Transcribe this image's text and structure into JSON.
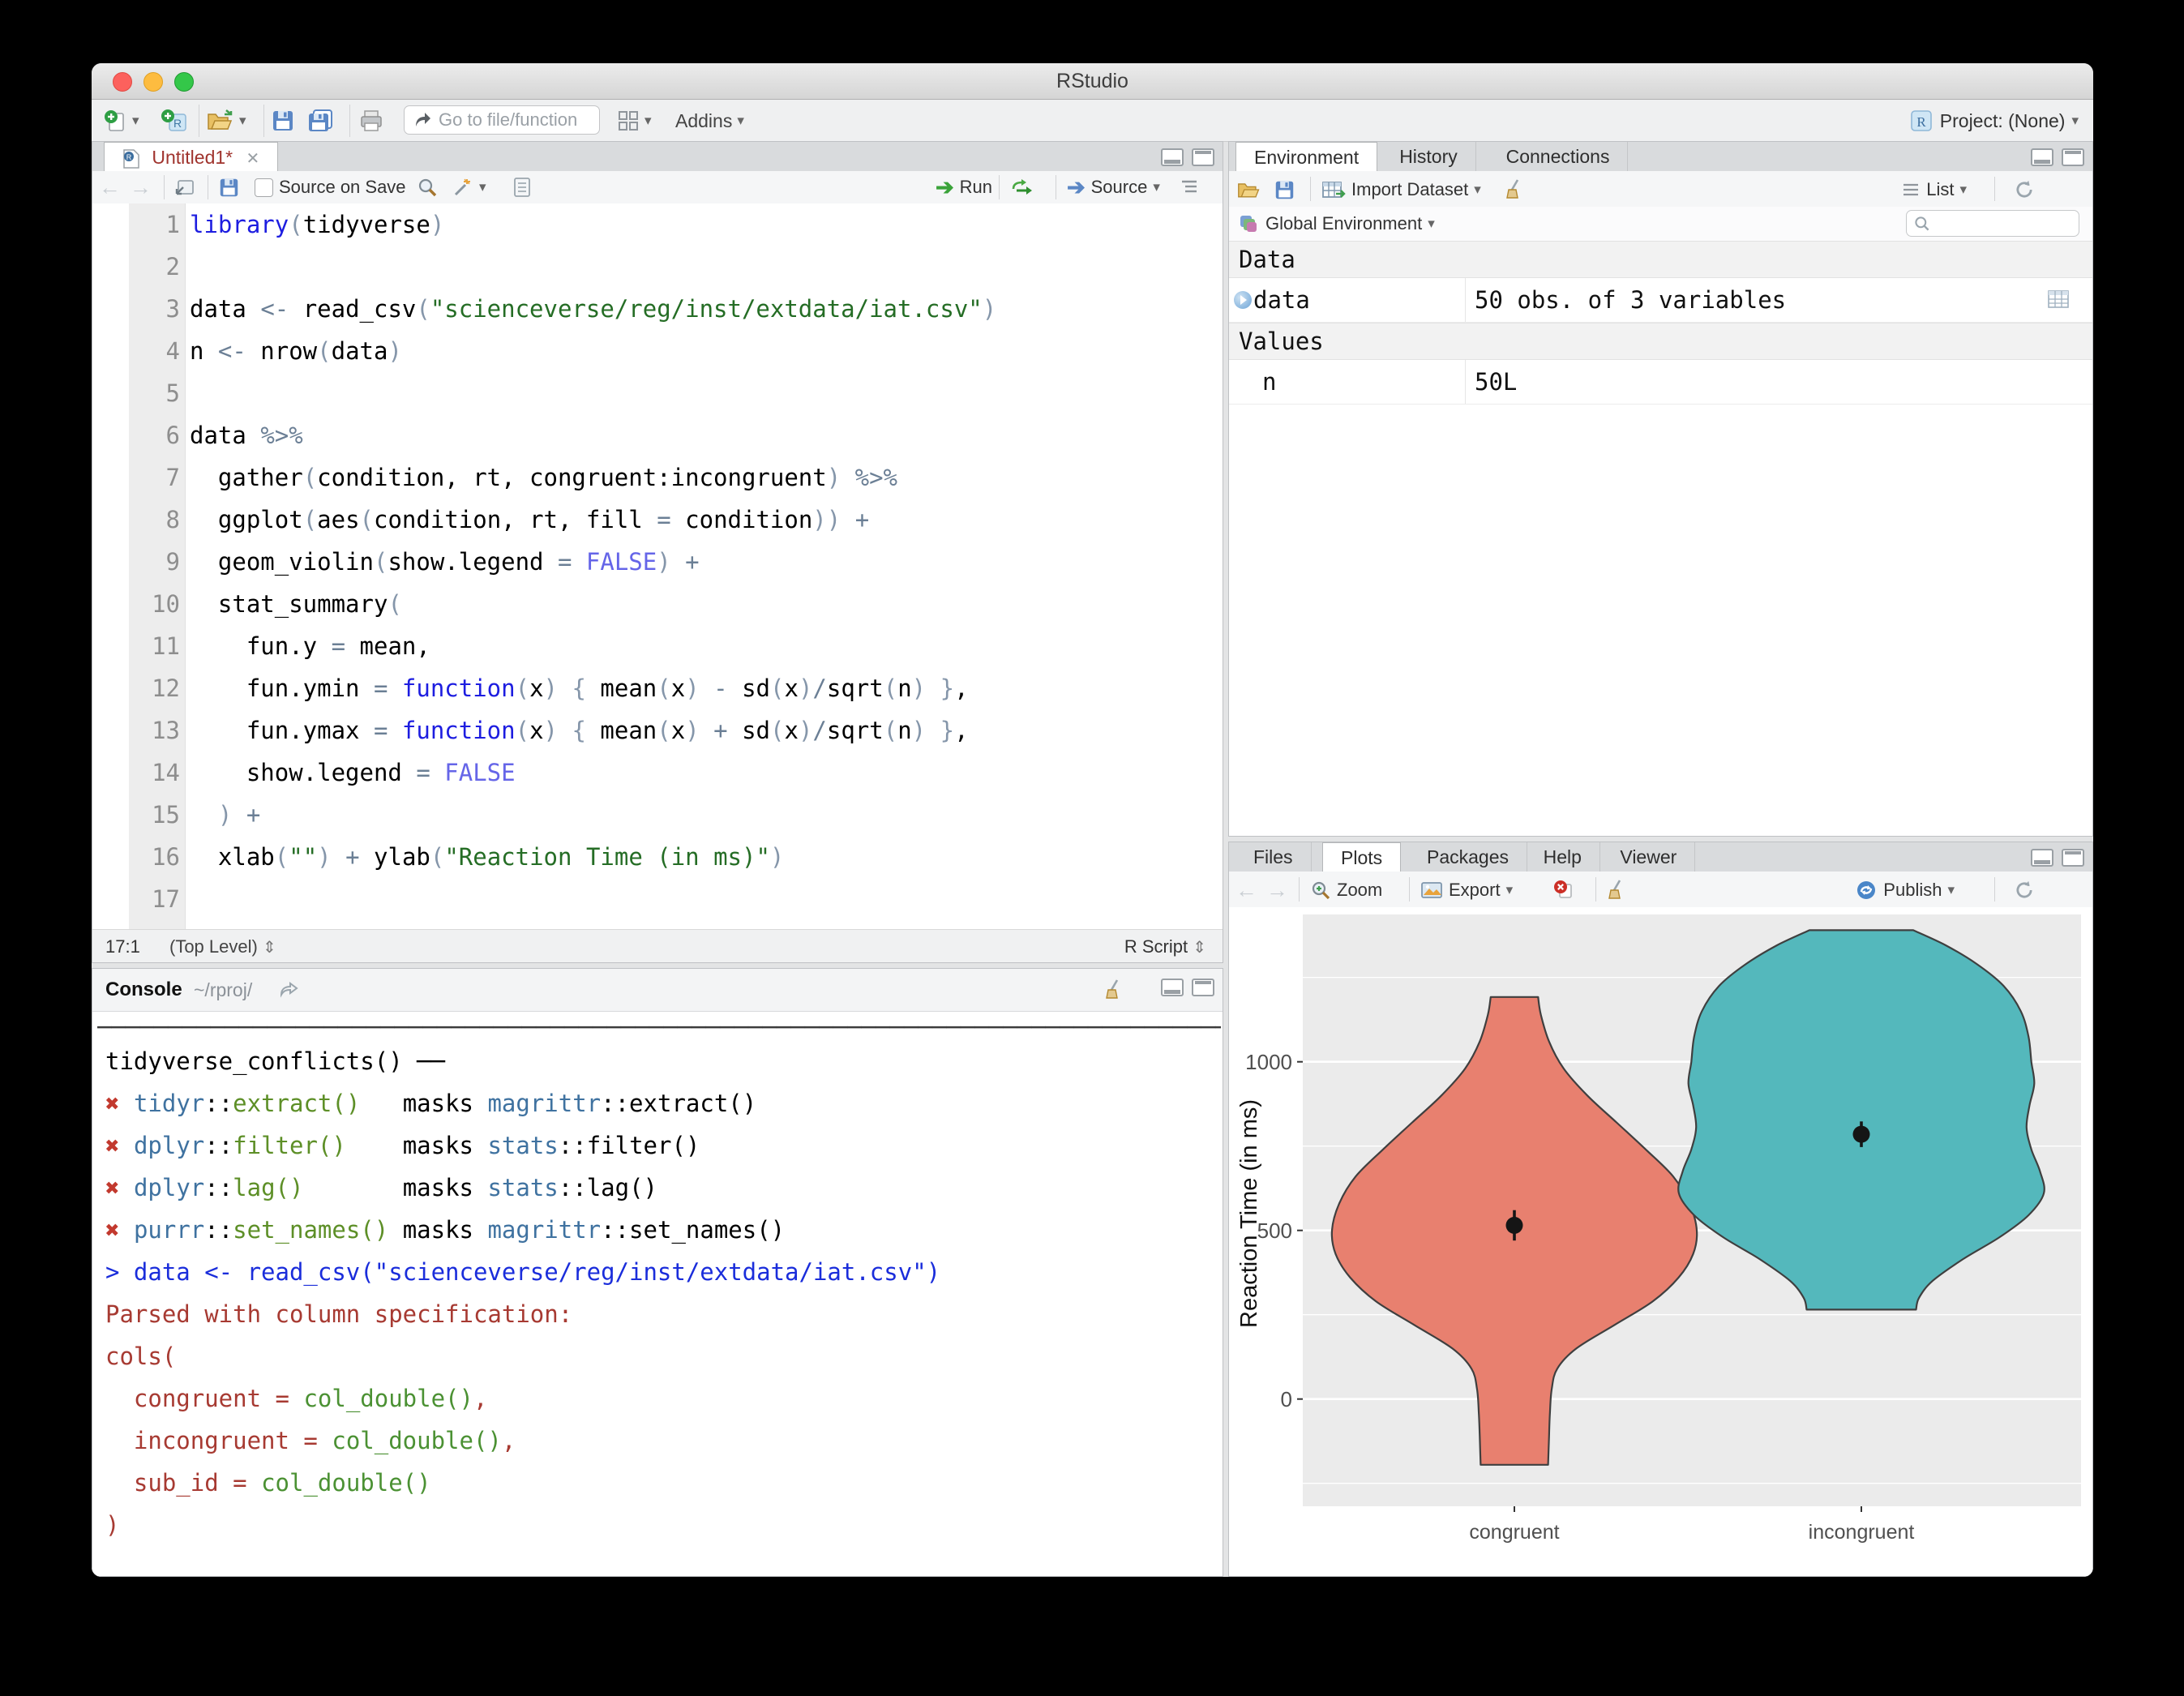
{
  "window": {
    "title": "RStudio",
    "project_label": "Project: (None)"
  },
  "main_toolbar": {
    "goto_placeholder": "Go to file/function",
    "addins_label": "Addins"
  },
  "source_pane": {
    "tab_title": "Untitled1*",
    "toolbar": {
      "source_on_save": "Source on Save",
      "run_label": "Run",
      "source_label": "Source"
    },
    "status": {
      "position": "17:1",
      "scope": "(Top Level)",
      "updown": "⇕",
      "type": "R Script"
    },
    "code_lines": [
      [
        [
          "kw",
          "library"
        ],
        [
          "pa",
          "("
        ],
        [
          "tx",
          "tidyverse"
        ],
        [
          "pa",
          ")"
        ]
      ],
      [],
      [
        [
          "tx",
          "data "
        ],
        [
          "op",
          "<-"
        ],
        [
          "tx",
          " read_csv"
        ],
        [
          "pa",
          "("
        ],
        [
          "str",
          "\"scienceverse/reg/inst/extdata/iat.csv\""
        ],
        [
          "pa",
          ")"
        ]
      ],
      [
        [
          "tx",
          "n "
        ],
        [
          "op",
          "<-"
        ],
        [
          "tx",
          " nrow"
        ],
        [
          "pa",
          "("
        ],
        [
          "tx",
          "data"
        ],
        [
          "pa",
          ")"
        ]
      ],
      [],
      [
        [
          "tx",
          "data "
        ],
        [
          "op",
          "%>%"
        ]
      ],
      [
        [
          "tx",
          "  gather"
        ],
        [
          "pa",
          "("
        ],
        [
          "tx",
          "condition, rt, congruent:incongruent"
        ],
        [
          "pa",
          ")"
        ],
        [
          "tx",
          " "
        ],
        [
          "op",
          "%>%"
        ]
      ],
      [
        [
          "tx",
          "  ggplot"
        ],
        [
          "pa",
          "("
        ],
        [
          "tx",
          "aes"
        ],
        [
          "pa",
          "("
        ],
        [
          "tx",
          "condition, rt, fill "
        ],
        [
          "op",
          "="
        ],
        [
          "tx",
          " condition"
        ],
        [
          "pa",
          "))"
        ],
        [
          "tx",
          " "
        ],
        [
          "op",
          "+"
        ]
      ],
      [
        [
          "tx",
          "  geom_violin"
        ],
        [
          "pa",
          "("
        ],
        [
          "tx",
          "show.legend "
        ],
        [
          "op",
          "="
        ],
        [
          "tx",
          " "
        ],
        [
          "co",
          "FALSE"
        ],
        [
          "pa",
          ")"
        ],
        [
          "tx",
          " "
        ],
        [
          "op",
          "+"
        ]
      ],
      [
        [
          "tx",
          "  stat_summary"
        ],
        [
          "pa",
          "("
        ]
      ],
      [
        [
          "tx",
          "    fun.y "
        ],
        [
          "op",
          "="
        ],
        [
          "tx",
          " mean,"
        ]
      ],
      [
        [
          "tx",
          "    fun.ymin "
        ],
        [
          "op",
          "="
        ],
        [
          "tx",
          " "
        ],
        [
          "kw",
          "function"
        ],
        [
          "pa",
          "("
        ],
        [
          "tx",
          "x"
        ],
        [
          "pa",
          ")"
        ],
        [
          "tx",
          " "
        ],
        [
          "pa",
          "{"
        ],
        [
          "tx",
          " mean"
        ],
        [
          "pa",
          "("
        ],
        [
          "tx",
          "x"
        ],
        [
          "pa",
          ")"
        ],
        [
          "tx",
          " "
        ],
        [
          "op",
          "-"
        ],
        [
          "tx",
          " sd"
        ],
        [
          "pa",
          "("
        ],
        [
          "tx",
          "x"
        ],
        [
          "pa",
          ")"
        ],
        [
          "op",
          "/"
        ],
        [
          "tx",
          "sqrt"
        ],
        [
          "pa",
          "("
        ],
        [
          "tx",
          "n"
        ],
        [
          "pa",
          ")"
        ],
        [
          "tx",
          " "
        ],
        [
          "pa",
          "}"
        ],
        [
          "tx",
          ","
        ]
      ],
      [
        [
          "tx",
          "    fun.ymax "
        ],
        [
          "op",
          "="
        ],
        [
          "tx",
          " "
        ],
        [
          "kw",
          "function"
        ],
        [
          "pa",
          "("
        ],
        [
          "tx",
          "x"
        ],
        [
          "pa",
          ")"
        ],
        [
          "tx",
          " "
        ],
        [
          "pa",
          "{"
        ],
        [
          "tx",
          " mean"
        ],
        [
          "pa",
          "("
        ],
        [
          "tx",
          "x"
        ],
        [
          "pa",
          ")"
        ],
        [
          "tx",
          " "
        ],
        [
          "op",
          "+"
        ],
        [
          "tx",
          " sd"
        ],
        [
          "pa",
          "("
        ],
        [
          "tx",
          "x"
        ],
        [
          "pa",
          ")"
        ],
        [
          "op",
          "/"
        ],
        [
          "tx",
          "sqrt"
        ],
        [
          "pa",
          "("
        ],
        [
          "tx",
          "n"
        ],
        [
          "pa",
          ")"
        ],
        [
          "tx",
          " "
        ],
        [
          "pa",
          "}"
        ],
        [
          "tx",
          ","
        ]
      ],
      [
        [
          "tx",
          "    show.legend "
        ],
        [
          "op",
          "="
        ],
        [
          "tx",
          " "
        ],
        [
          "co",
          "FALSE"
        ]
      ],
      [
        [
          "tx",
          "  "
        ],
        [
          "pa",
          ")"
        ],
        [
          "tx",
          " "
        ],
        [
          "op",
          "+"
        ]
      ],
      [
        [
          "tx",
          "  xlab"
        ],
        [
          "pa",
          "("
        ],
        [
          "str",
          "\"\""
        ],
        [
          "pa",
          ")"
        ],
        [
          "tx",
          " "
        ],
        [
          "op",
          "+"
        ],
        [
          "tx",
          " ylab"
        ],
        [
          "pa",
          "("
        ],
        [
          "str",
          "\"Reaction Time (in ms)\""
        ],
        [
          "pa",
          ")"
        ]
      ],
      []
    ]
  },
  "console_pane": {
    "title": "Console",
    "path": "~/rproj/",
    "rule": "────────────────────────────────────────────────────────────────────────────────",
    "lines": [
      [
        [
          "tx",
          "tidyverse_conflicts() ──"
        ]
      ],
      [
        [
          "xx",
          "✖"
        ],
        [
          "tx",
          " "
        ],
        [
          "pk",
          "tidyr"
        ],
        [
          "tx",
          "::"
        ],
        [
          "fn",
          "extract()"
        ],
        [
          "tx",
          "   masks "
        ],
        [
          "pk",
          "magrittr"
        ],
        [
          "tx",
          "::extract()"
        ]
      ],
      [
        [
          "xx",
          "✖"
        ],
        [
          "tx",
          " "
        ],
        [
          "pk",
          "dplyr"
        ],
        [
          "tx",
          "::"
        ],
        [
          "fn",
          "filter()"
        ],
        [
          "tx",
          "    masks "
        ],
        [
          "pk",
          "stats"
        ],
        [
          "tx",
          "::filter()"
        ]
      ],
      [
        [
          "xx",
          "✖"
        ],
        [
          "tx",
          " "
        ],
        [
          "pk",
          "dplyr"
        ],
        [
          "tx",
          "::"
        ],
        [
          "fn",
          "lag()"
        ],
        [
          "tx",
          "       masks "
        ],
        [
          "pk",
          "stats"
        ],
        [
          "tx",
          "::lag()"
        ]
      ],
      [
        [
          "xx",
          "✖"
        ],
        [
          "tx",
          " "
        ],
        [
          "pk",
          "purrr"
        ],
        [
          "tx",
          "::"
        ],
        [
          "fn",
          "set_names()"
        ],
        [
          "tx",
          " masks "
        ],
        [
          "pk",
          "magrittr"
        ],
        [
          "tx",
          "::set_names()"
        ]
      ],
      [
        [
          "cmd",
          "> data <- read_csv(\"scienceverse/reg/inst/extdata/iat.csv\")"
        ]
      ],
      [
        [
          "er",
          "Parsed with column specification:"
        ]
      ],
      [
        [
          "er",
          "cols("
        ]
      ],
      [
        [
          "er",
          "  congruent = "
        ],
        [
          "gr",
          "col_double()"
        ],
        [
          "er",
          ","
        ]
      ],
      [
        [
          "er",
          "  incongruent = "
        ],
        [
          "gr",
          "col_double()"
        ],
        [
          "er",
          ","
        ]
      ],
      [
        [
          "er",
          "  sub_id = "
        ],
        [
          "gr",
          "col_double()"
        ]
      ],
      [
        [
          "er",
          ")"
        ]
      ]
    ]
  },
  "environment_pane": {
    "tabs": [
      "Environment",
      "History",
      "Connections"
    ],
    "active_tab": "Environment",
    "toolbar": {
      "import_label": "Import Dataset",
      "list_label": "List"
    },
    "scope_label": "Global Environment",
    "sections": [
      {
        "header": "Data",
        "rows": [
          {
            "name": "data",
            "value": "50 obs. of 3 variables",
            "expandable": true,
            "table_icon": true,
            "indent": false
          }
        ]
      },
      {
        "header": "Values",
        "rows": [
          {
            "name": "n",
            "value": "50L",
            "expandable": false,
            "table_icon": false,
            "indent": true
          }
        ]
      }
    ]
  },
  "plots_pane": {
    "tabs": [
      "Files",
      "Plots",
      "Packages",
      "Help",
      "Viewer"
    ],
    "active_tab": "Plots",
    "toolbar": {
      "zoom_label": "Zoom",
      "export_label": "Export",
      "publish_label": "Publish"
    }
  },
  "chart_data": {
    "type": "violin",
    "title": "",
    "xlabel": "",
    "ylabel": "Reaction Time (in ms)",
    "categories": [
      "congruent",
      "incongruent"
    ],
    "y_ticks": [
      0,
      500,
      1000
    ],
    "y_minor_gridlines": [
      -250,
      250,
      750,
      1250
    ],
    "ylim": [
      -318,
      1415
    ],
    "grid": true,
    "legend": "none",
    "panel_bg": "#EBEBEB",
    "grid_color": "#FFFFFF",
    "outline_color": "#3f3f3f",
    "series": [
      {
        "name": "congruent",
        "fill": "#E8806F",
        "mean": 515,
        "se_low": 470,
        "se_high": 560,
        "profile": [
          [
            1192,
            0.13
          ],
          [
            1140,
            0.145
          ],
          [
            1060,
            0.19
          ],
          [
            980,
            0.27
          ],
          [
            900,
            0.4
          ],
          [
            820,
            0.56
          ],
          [
            740,
            0.72
          ],
          [
            660,
            0.87
          ],
          [
            580,
            0.96
          ],
          [
            500,
            1.0
          ],
          [
            430,
            0.98
          ],
          [
            360,
            0.9
          ],
          [
            290,
            0.76
          ],
          [
            220,
            0.55
          ],
          [
            150,
            0.34
          ],
          [
            90,
            0.235
          ],
          [
            30,
            0.205
          ],
          [
            -40,
            0.195
          ],
          [
            -110,
            0.19
          ],
          [
            -195,
            0.185
          ]
        ],
        "max_half_width": 225
      },
      {
        "name": "incongruent",
        "fill": "#54B8BC",
        "mean": 785,
        "se_low": 747,
        "se_high": 823,
        "profile": [
          [
            1390,
            0.27
          ],
          [
            1345,
            0.44
          ],
          [
            1290,
            0.6
          ],
          [
            1225,
            0.74
          ],
          [
            1150,
            0.83
          ],
          [
            1075,
            0.87
          ],
          [
            1000,
            0.885
          ],
          [
            935,
            0.9
          ],
          [
            870,
            0.875
          ],
          [
            805,
            0.86
          ],
          [
            740,
            0.885
          ],
          [
            675,
            0.93
          ],
          [
            610,
            0.95
          ],
          [
            545,
            0.87
          ],
          [
            480,
            0.72
          ],
          [
            415,
            0.53
          ],
          [
            350,
            0.37
          ],
          [
            300,
            0.3
          ],
          [
            265,
            0.285
          ]
        ],
        "max_half_width": 237
      }
    ]
  }
}
